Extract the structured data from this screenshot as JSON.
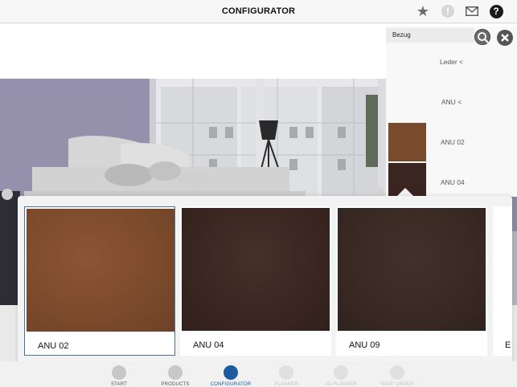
{
  "header": {
    "title": "CONFIGURATOR",
    "icons": [
      "star-icon",
      "alert-icon",
      "mail-icon",
      "help-icon"
    ],
    "alert_glyph": "!",
    "help_glyph": "?"
  },
  "panel": {
    "search_label": "Bezug",
    "rows": [
      "Leder <",
      "ANU <"
    ],
    "swatches": [
      {
        "label": "ANU 02",
        "color": "#7a4a2c"
      },
      {
        "label": "ANU 04",
        "color": "#3a2520"
      }
    ]
  },
  "tray": {
    "selected": "ANU 02",
    "cards": [
      {
        "label": "ANU 02",
        "color": "#7d4b2c",
        "selected": true
      },
      {
        "label": "ANU 04",
        "color": "#3b2621",
        "selected": false
      },
      {
        "label": "ANU 09",
        "color": "#3a2a24",
        "selected": false
      },
      {
        "label": "E",
        "color": "#ffffff",
        "selected": false
      }
    ]
  },
  "tabbar": {
    "tabs": [
      {
        "label": "START",
        "icon": "home-icon",
        "state": "normal"
      },
      {
        "label": "PRODUCTS",
        "icon": "grid-icon",
        "state": "normal"
      },
      {
        "label": "CONFIGURATOR",
        "icon": "wrench-icon",
        "state": "active"
      },
      {
        "label": "PLANNER",
        "icon": "planner-icon",
        "state": "disabled"
      },
      {
        "label": "3D PLANNER",
        "icon": "3d-icon",
        "state": "disabled"
      },
      {
        "label": "SAVE ORDER",
        "icon": "cart-icon",
        "state": "disabled"
      }
    ]
  },
  "colors": {
    "accent": "#1d5ba0",
    "selected_border": "#4a6f98",
    "wall": "#8a86a0",
    "sofa": "#d9d9d9"
  }
}
